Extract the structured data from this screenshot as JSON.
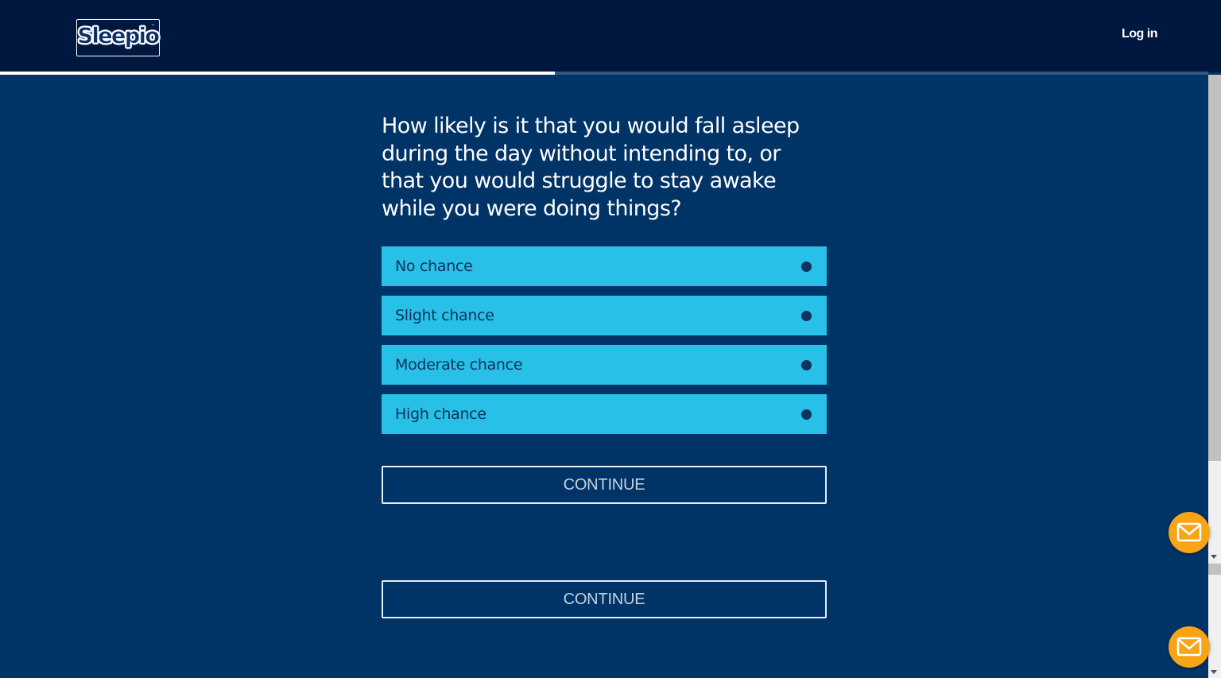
{
  "header": {
    "logo_text": "Sleepio",
    "logo_mark": "™",
    "login_label": "Log in"
  },
  "progress": {
    "fraction": 0.459
  },
  "question": {
    "text": "How likely is it that you would fall asleep during the day without intending to, or that you would struggle to stay awake while you were doing things?"
  },
  "options": [
    {
      "label": "No chance"
    },
    {
      "label": "Slight chance"
    },
    {
      "label": "Moderate chance"
    },
    {
      "label": "High chance"
    }
  ],
  "buttons": {
    "continue_primary": "CONTINUE",
    "continue_secondary": "CONTINUE"
  },
  "icons": {
    "contact": "mail-icon"
  },
  "colors": {
    "header_bg": "#00173f",
    "page_bg": "#003366",
    "option_bg": "#28c0e6",
    "option_text": "#0f3159",
    "mail_button": "#f7a416"
  }
}
